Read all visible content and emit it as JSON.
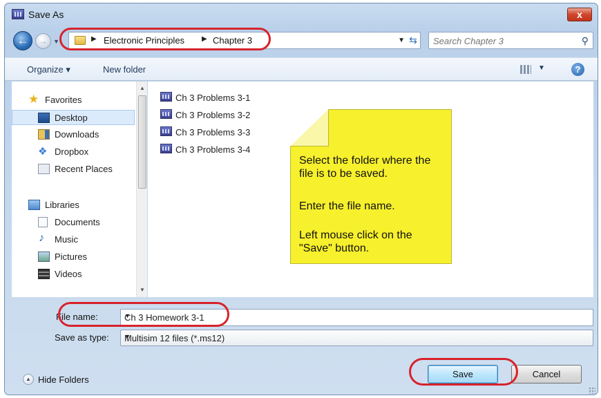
{
  "window": {
    "title": "Save As",
    "close_label": "x"
  },
  "address": {
    "crumbs": [
      "Electronic Principles",
      "Chapter 3"
    ],
    "search_placeholder": "Search Chapter 3"
  },
  "toolbar": {
    "organize_label": "Organize ▾",
    "new_folder_label": "New folder"
  },
  "nav_pane": {
    "favorites_header": "Favorites",
    "favorites": [
      "Desktop",
      "Downloads",
      "Dropbox",
      "Recent Places"
    ],
    "libraries_header": "Libraries",
    "libraries": [
      "Documents",
      "Music",
      "Pictures",
      "Videos"
    ],
    "selected": "Desktop"
  },
  "files": [
    {
      "name": "Ch 3 Problems 3-1",
      "icon": "multisim-file-icon"
    },
    {
      "name": "Ch 3 Problems 3-2",
      "icon": "multisim-file-icon"
    },
    {
      "name": "Ch 3 Problems 3-3",
      "icon": "multisim-file-icon"
    },
    {
      "name": "Ch 3 Problems 3-4",
      "icon": "multisim-file-icon"
    }
  ],
  "note": {
    "line1": "Select the folder where the file is to be saved.",
    "line2": "Enter the file name.",
    "line3": "Left mouse click on the \"Save\" button."
  },
  "form": {
    "filename_label": "File name:",
    "filename_value": "Ch 3 Homework 3-1",
    "type_label": "Save as type:",
    "type_value": "Multisim 12 files (*.ms12)"
  },
  "footer": {
    "hide_folders_label": "Hide Folders",
    "save_label": "Save",
    "cancel_label": "Cancel"
  },
  "colors": {
    "highlight": "#d8222b",
    "note": "#f7f02c",
    "accent": "#2a6cb8"
  }
}
